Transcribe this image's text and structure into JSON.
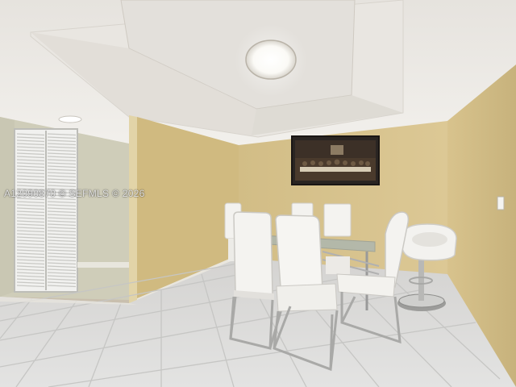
{
  "photo": {
    "watermark": "A12090870 © SEFMLS © 2026",
    "colors": {
      "wall": "#d6c28f",
      "wall_shadow": "#c4b07c",
      "ceiling": "#ece9e4",
      "floor_tile": "#dcdcdb",
      "grout": "#c6c6c4",
      "chair": "#f3f2ef",
      "glass": "#a8b5b3",
      "chrome": "#9a9a9a",
      "louver_door": "#f1f1ef"
    },
    "objects": [
      "ceiling-light",
      "recessed-light",
      "tray-ceiling",
      "louvered-closet-door",
      "framed-painting",
      "glass-dining-table",
      "white-dining-chairs",
      "white-bar-stool",
      "tile-floor",
      "wall-outlet"
    ]
  }
}
